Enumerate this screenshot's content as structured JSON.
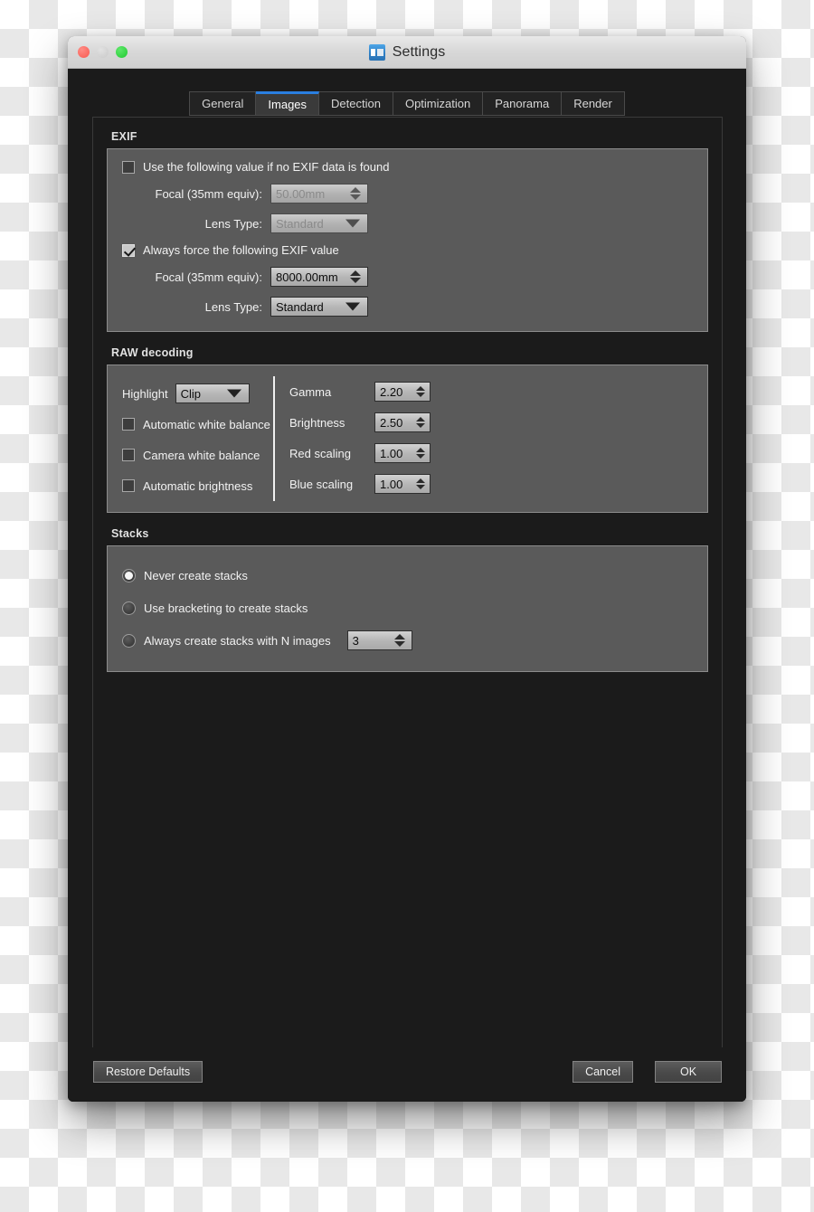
{
  "window": {
    "title": "Settings",
    "app_icon": "app-icon",
    "traffic_lights": {
      "close": "close-button",
      "minimize": "minimize-button",
      "zoom": "zoom-button"
    },
    "accent_color": "#2a7fe0"
  },
  "tabs": [
    {
      "label": "General",
      "active": false
    },
    {
      "label": "Images",
      "active": true
    },
    {
      "label": "Detection",
      "active": false
    },
    {
      "label": "Optimization",
      "active": false
    },
    {
      "label": "Panorama",
      "active": false
    },
    {
      "label": "Render",
      "active": false
    }
  ],
  "exif": {
    "group_title": "EXIF",
    "no_exif_checkbox": {
      "label": "Use the following value if no EXIF data is found",
      "checked": false
    },
    "no_exif_focal": {
      "label": "Focal (35mm equiv):",
      "value": "50.00mm",
      "disabled": true
    },
    "no_exif_lens": {
      "label": "Lens Type:",
      "value": "Standard",
      "disabled": true
    },
    "force_checkbox": {
      "label": "Always force the following EXIF value",
      "checked": true
    },
    "force_focal": {
      "label": "Focal (35mm equiv):",
      "value": "8000.00mm",
      "disabled": false
    },
    "force_lens": {
      "label": "Lens Type:",
      "value": "Standard",
      "disabled": false
    }
  },
  "raw": {
    "group_title": "RAW decoding",
    "highlight_label": "Highlight",
    "highlight_value": "Clip",
    "checkboxes": [
      {
        "label": "Automatic white balance",
        "checked": false
      },
      {
        "label": "Camera white balance",
        "checked": false
      },
      {
        "label": "Automatic brightness",
        "checked": false
      }
    ],
    "numerics": [
      {
        "label": "Gamma",
        "value": "2.20"
      },
      {
        "label": "Brightness",
        "value": "2.50"
      },
      {
        "label": "Red scaling",
        "value": "1.00"
      },
      {
        "label": "Blue scaling",
        "value": "1.00"
      }
    ]
  },
  "stacks": {
    "group_title": "Stacks",
    "options": [
      {
        "label": "Never create stacks",
        "selected": true
      },
      {
        "label": "Use bracketing to create stacks",
        "selected": false
      },
      {
        "label": "Always create stacks with N images",
        "selected": false
      }
    ],
    "n_images": "3"
  },
  "footer": {
    "restore_label": "Restore Defaults",
    "cancel_label": "Cancel",
    "ok_label": "OK"
  }
}
